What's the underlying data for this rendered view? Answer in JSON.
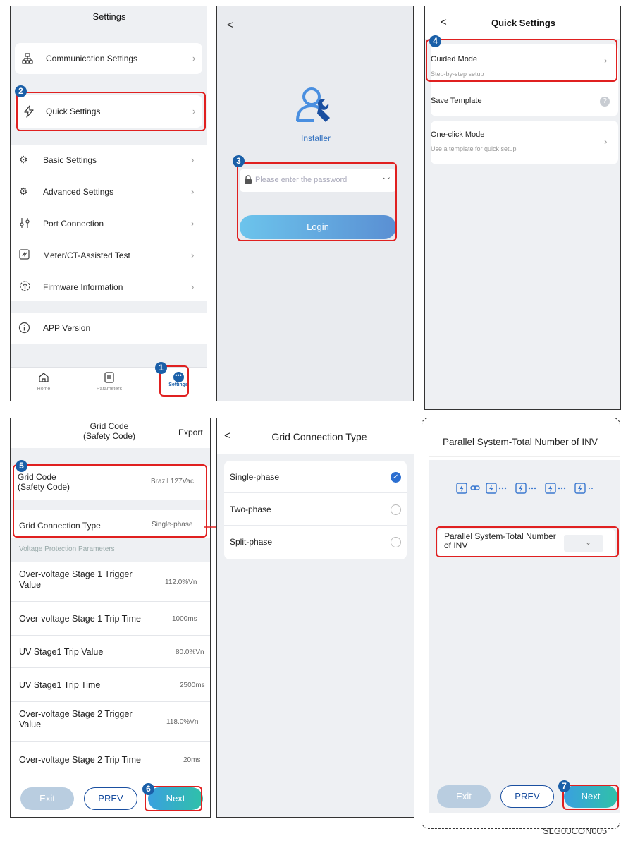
{
  "panel1": {
    "title": "Settings",
    "items": [
      {
        "label": "Communication Settings",
        "icon": "network-icon"
      },
      {
        "label": "Quick Settings",
        "icon": "lightning-icon"
      },
      {
        "label": "Basic Settings",
        "icon": "gear-icon"
      },
      {
        "label": "Advanced Settings",
        "icon": "advanced-gear-icon"
      },
      {
        "label": "Port Connection",
        "icon": "port-icon"
      },
      {
        "label": "Meter/CT-Assisted Test",
        "icon": "meter-icon"
      },
      {
        "label": "Firmware Information",
        "icon": "firmware-icon"
      },
      {
        "label": "APP Version",
        "icon": "info-icon"
      }
    ],
    "tabs": [
      {
        "label": "Home",
        "icon": "home-icon"
      },
      {
        "label": "Parameters",
        "icon": "parameters-icon"
      },
      {
        "label": "Settings",
        "icon": "more-icon"
      }
    ]
  },
  "panel2": {
    "back": "<",
    "role": "Installer",
    "password_placeholder": "Please enter the password",
    "login": "Login"
  },
  "panel3": {
    "back": "<",
    "title": "Quick Settings",
    "guided_title": "Guided Mode",
    "guided_sub": "Step-by-step setup",
    "save_template": "Save Template",
    "oneclick_title": "One-click Mode",
    "oneclick_sub": "Use a template for quick setup"
  },
  "panel4": {
    "title": "Grid Code\n(Safety Code)",
    "export": "Export",
    "grid_code_label": "Grid Code\n(Safety Code)",
    "grid_code_value": "Brazil 127Vac",
    "grid_conn_label": "Grid Connection Type",
    "grid_conn_value": "Single-phase",
    "section": "Voltage Protection Parameters",
    "params": [
      {
        "label": "Over-voltage Stage 1 Trigger Value",
        "value": "112.0%Vn"
      },
      {
        "label": "Over-voltage Stage 1 Trip Time",
        "value": "1000ms"
      },
      {
        "label": "UV Stage1 Trip Value",
        "value": "80.0%Vn"
      },
      {
        "label": "UV Stage1 Trip Time",
        "value": "2500ms"
      },
      {
        "label": "Over-voltage Stage 2 Trigger Value",
        "value": "118.0%Vn"
      },
      {
        "label": "Over-voltage Stage 2 Trip Time",
        "value": "20ms"
      }
    ],
    "exit": "Exit",
    "prev": "PREV",
    "next": "Next"
  },
  "panel5": {
    "back": "<",
    "title": "Grid Connection Type",
    "options": [
      {
        "label": "Single-phase",
        "selected": true
      },
      {
        "label": "Two-phase",
        "selected": false
      },
      {
        "label": "Split-phase",
        "selected": false
      }
    ]
  },
  "panel6": {
    "title": "Parallel System-Total Number of INV",
    "field_label": "Parallel System-Total Number of INV",
    "exit": "Exit",
    "prev": "PREV",
    "next": "Next"
  },
  "badges": [
    "1",
    "2",
    "3",
    "4",
    "5",
    "6",
    "7"
  ],
  "caption": "SLG00CON005",
  "colors": {
    "accent": "#1a5fa8",
    "highlight": "#e02020",
    "next_gradient_start": "#3aa0e0",
    "next_gradient_end": "#2fc1a8",
    "check": "#2c6fd1"
  }
}
